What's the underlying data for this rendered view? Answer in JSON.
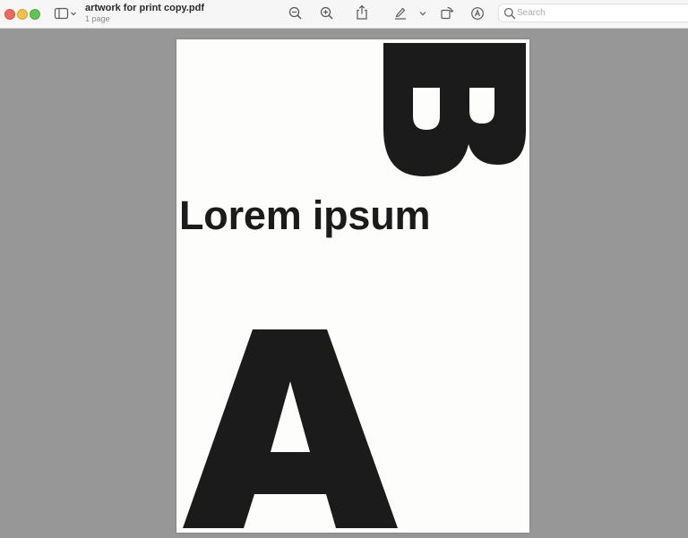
{
  "window": {
    "controls": [
      "close-icon",
      "minimize-icon",
      "zoom-icon"
    ]
  },
  "toolbar": {
    "sidebar_toggle_icon": "sidebar-icon",
    "document": {
      "title": "artwork for print copy.pdf",
      "subtitle": "1 page"
    },
    "actions": [
      {
        "name": "zoom-out",
        "icon": "zoom-out-icon"
      },
      {
        "name": "zoom-in",
        "icon": "zoom-in-icon"
      },
      {
        "name": "share",
        "icon": "share-icon"
      },
      {
        "name": "highlight",
        "icon": "pen-icon"
      },
      {
        "name": "highlight-menu",
        "icon": "chevron-down-icon"
      },
      {
        "name": "rotate",
        "icon": "rotate-icon"
      },
      {
        "name": "markup",
        "icon": "markup-icon"
      }
    ],
    "search": {
      "placeholder": "Search",
      "value": ""
    }
  },
  "page": {
    "heading": "Lorem ipsum",
    "glyph_top": "B",
    "glyph_bottom": "A"
  },
  "colors": {
    "background": "#979797",
    "toolbar": "#f6f6f6",
    "page": "#fdfdfb",
    "ink": "#1b1b1b",
    "close": "#ed6a5e",
    "minimize": "#f5bf4f",
    "zoom": "#61c554"
  }
}
